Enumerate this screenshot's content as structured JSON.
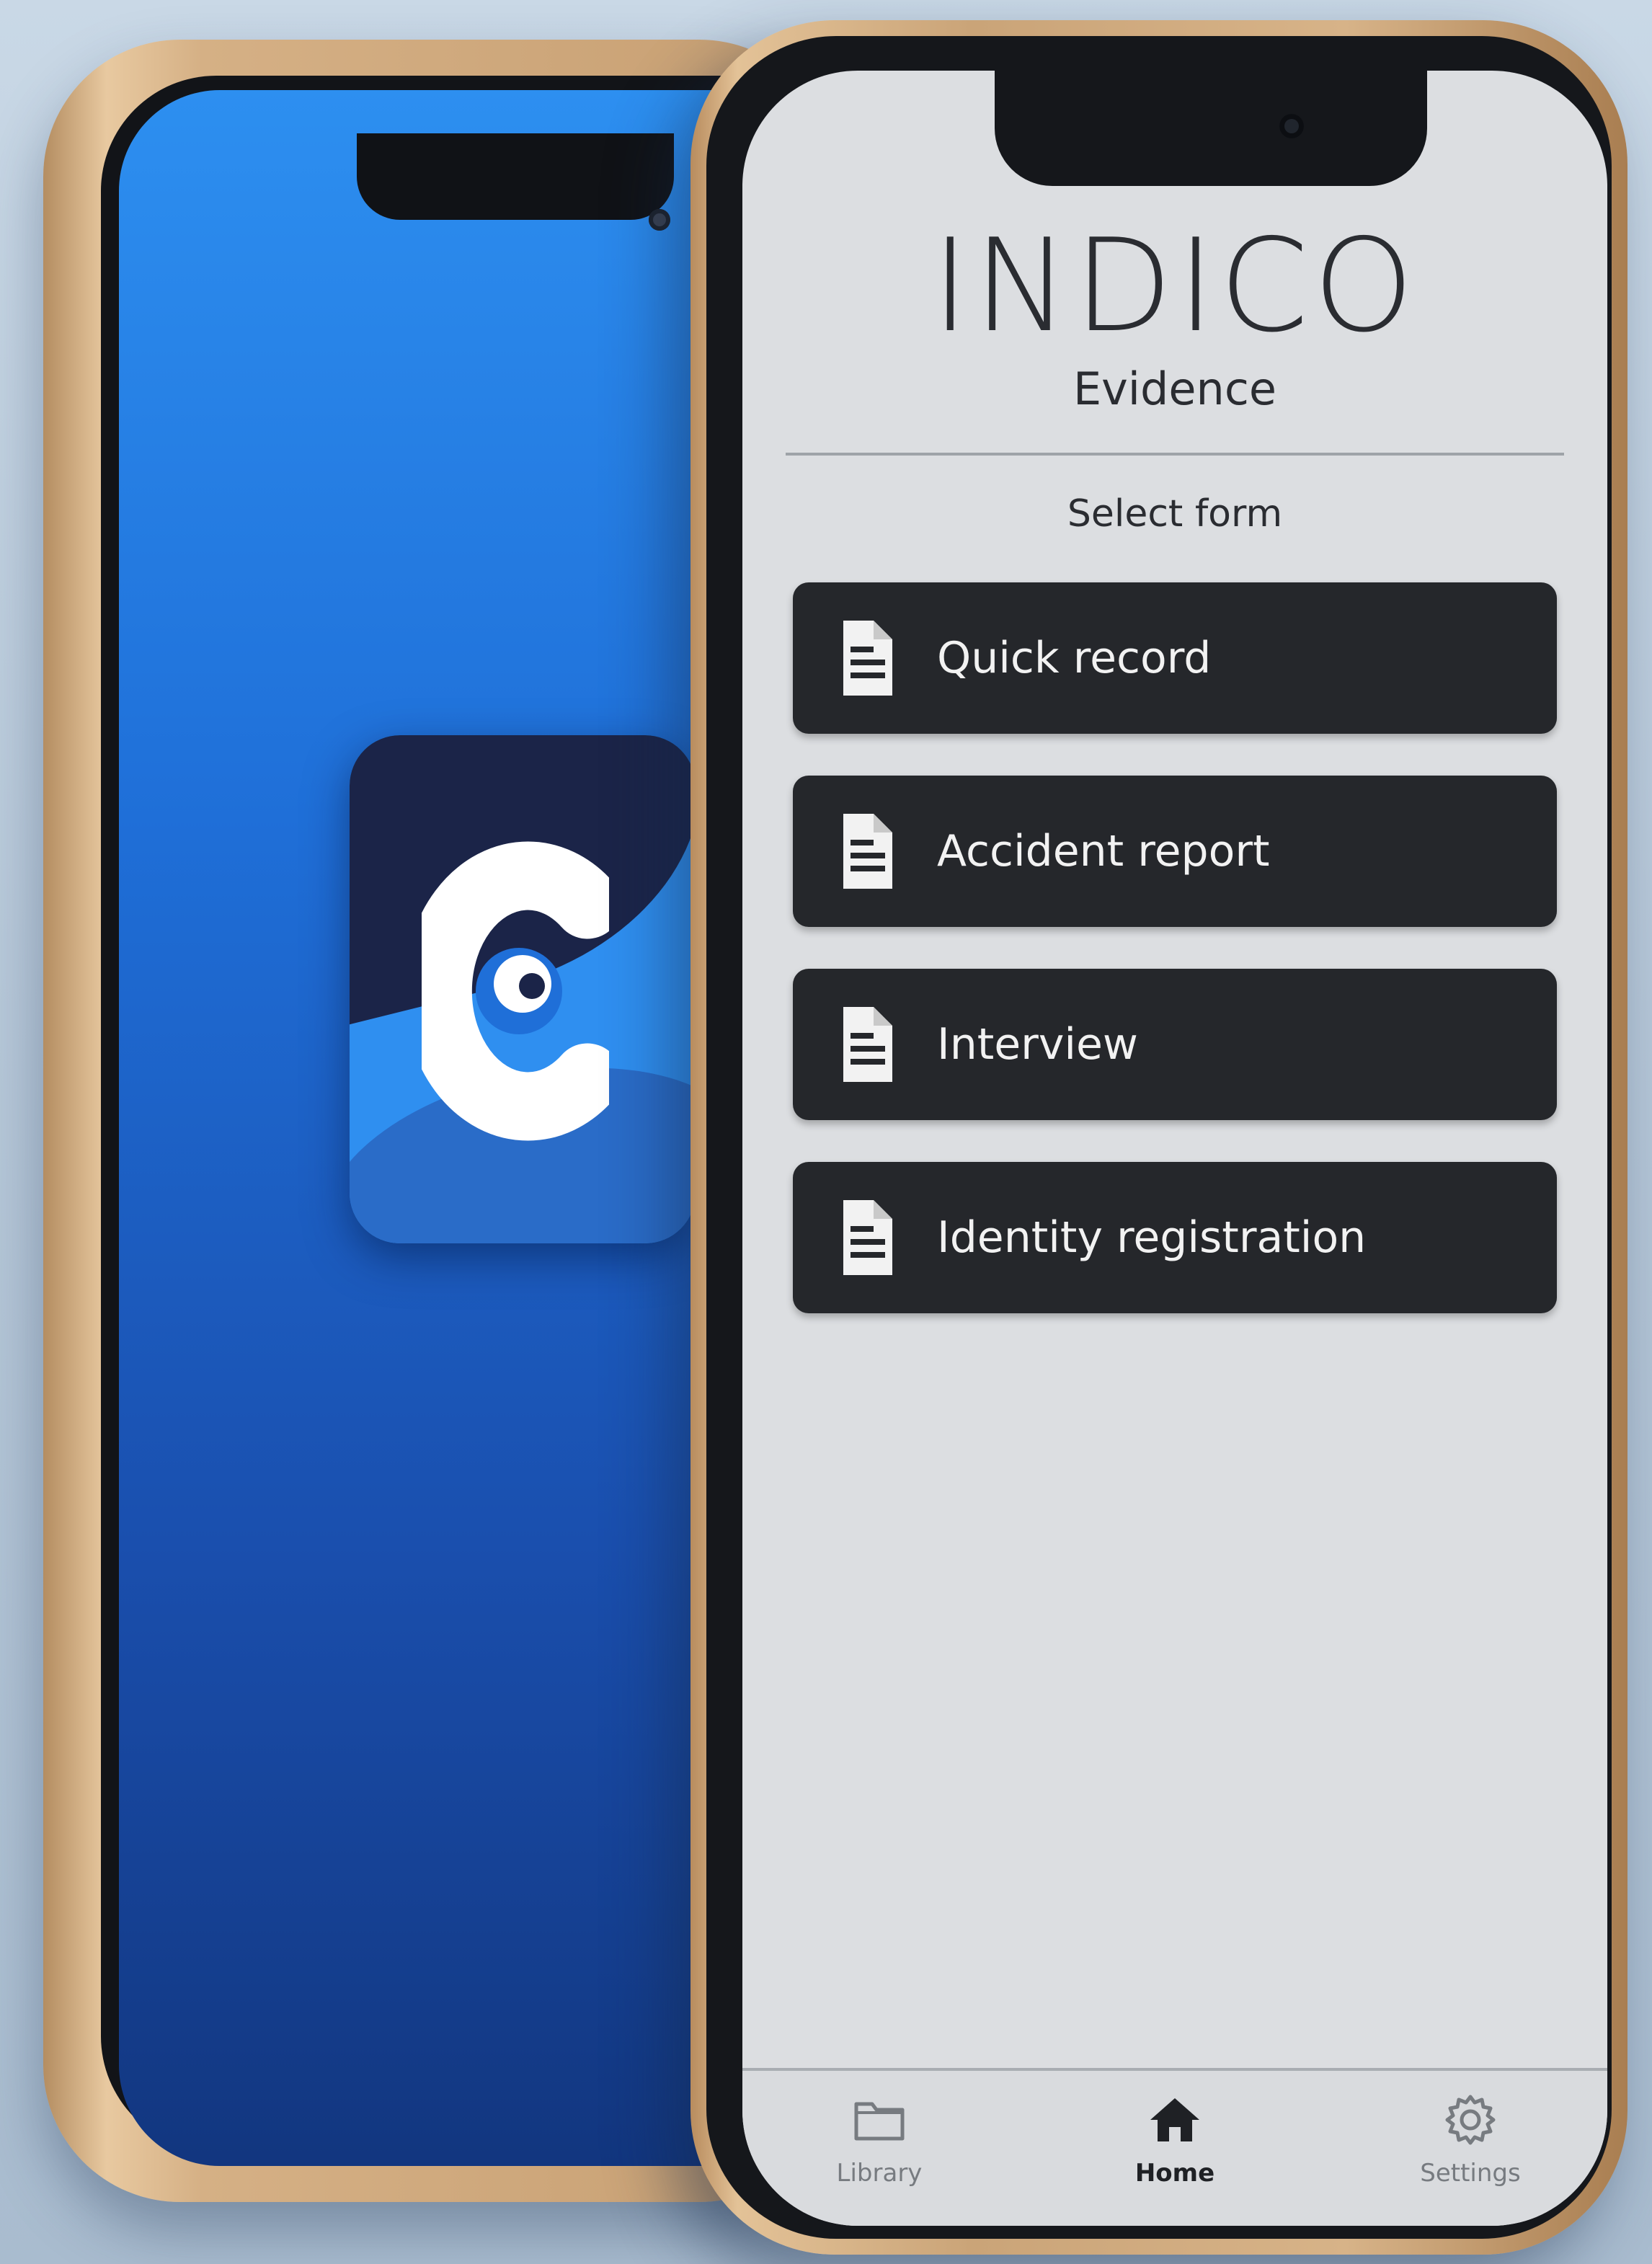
{
  "app": {
    "logo_text": "INDICO",
    "subtitle": "Evidence",
    "section_label": "Select form"
  },
  "forms": [
    {
      "label": "Quick record",
      "icon": "document-icon"
    },
    {
      "label": "Accident report",
      "icon": "document-icon"
    },
    {
      "label": "Interview",
      "icon": "document-icon"
    },
    {
      "label": "Identity registration",
      "icon": "document-icon"
    }
  ],
  "tabbar": {
    "library": {
      "label": "Library",
      "icon": "folder-icon"
    },
    "home": {
      "label": "Home",
      "icon": "home-icon",
      "active": true
    },
    "settings": {
      "label": "Settings",
      "icon": "gear-icon"
    }
  },
  "colors": {
    "button_bg": "#25272b",
    "screen_bg": "#dcdee1",
    "brand_blue": "#2d8ff0",
    "frame_gold": "#d5b085"
  }
}
